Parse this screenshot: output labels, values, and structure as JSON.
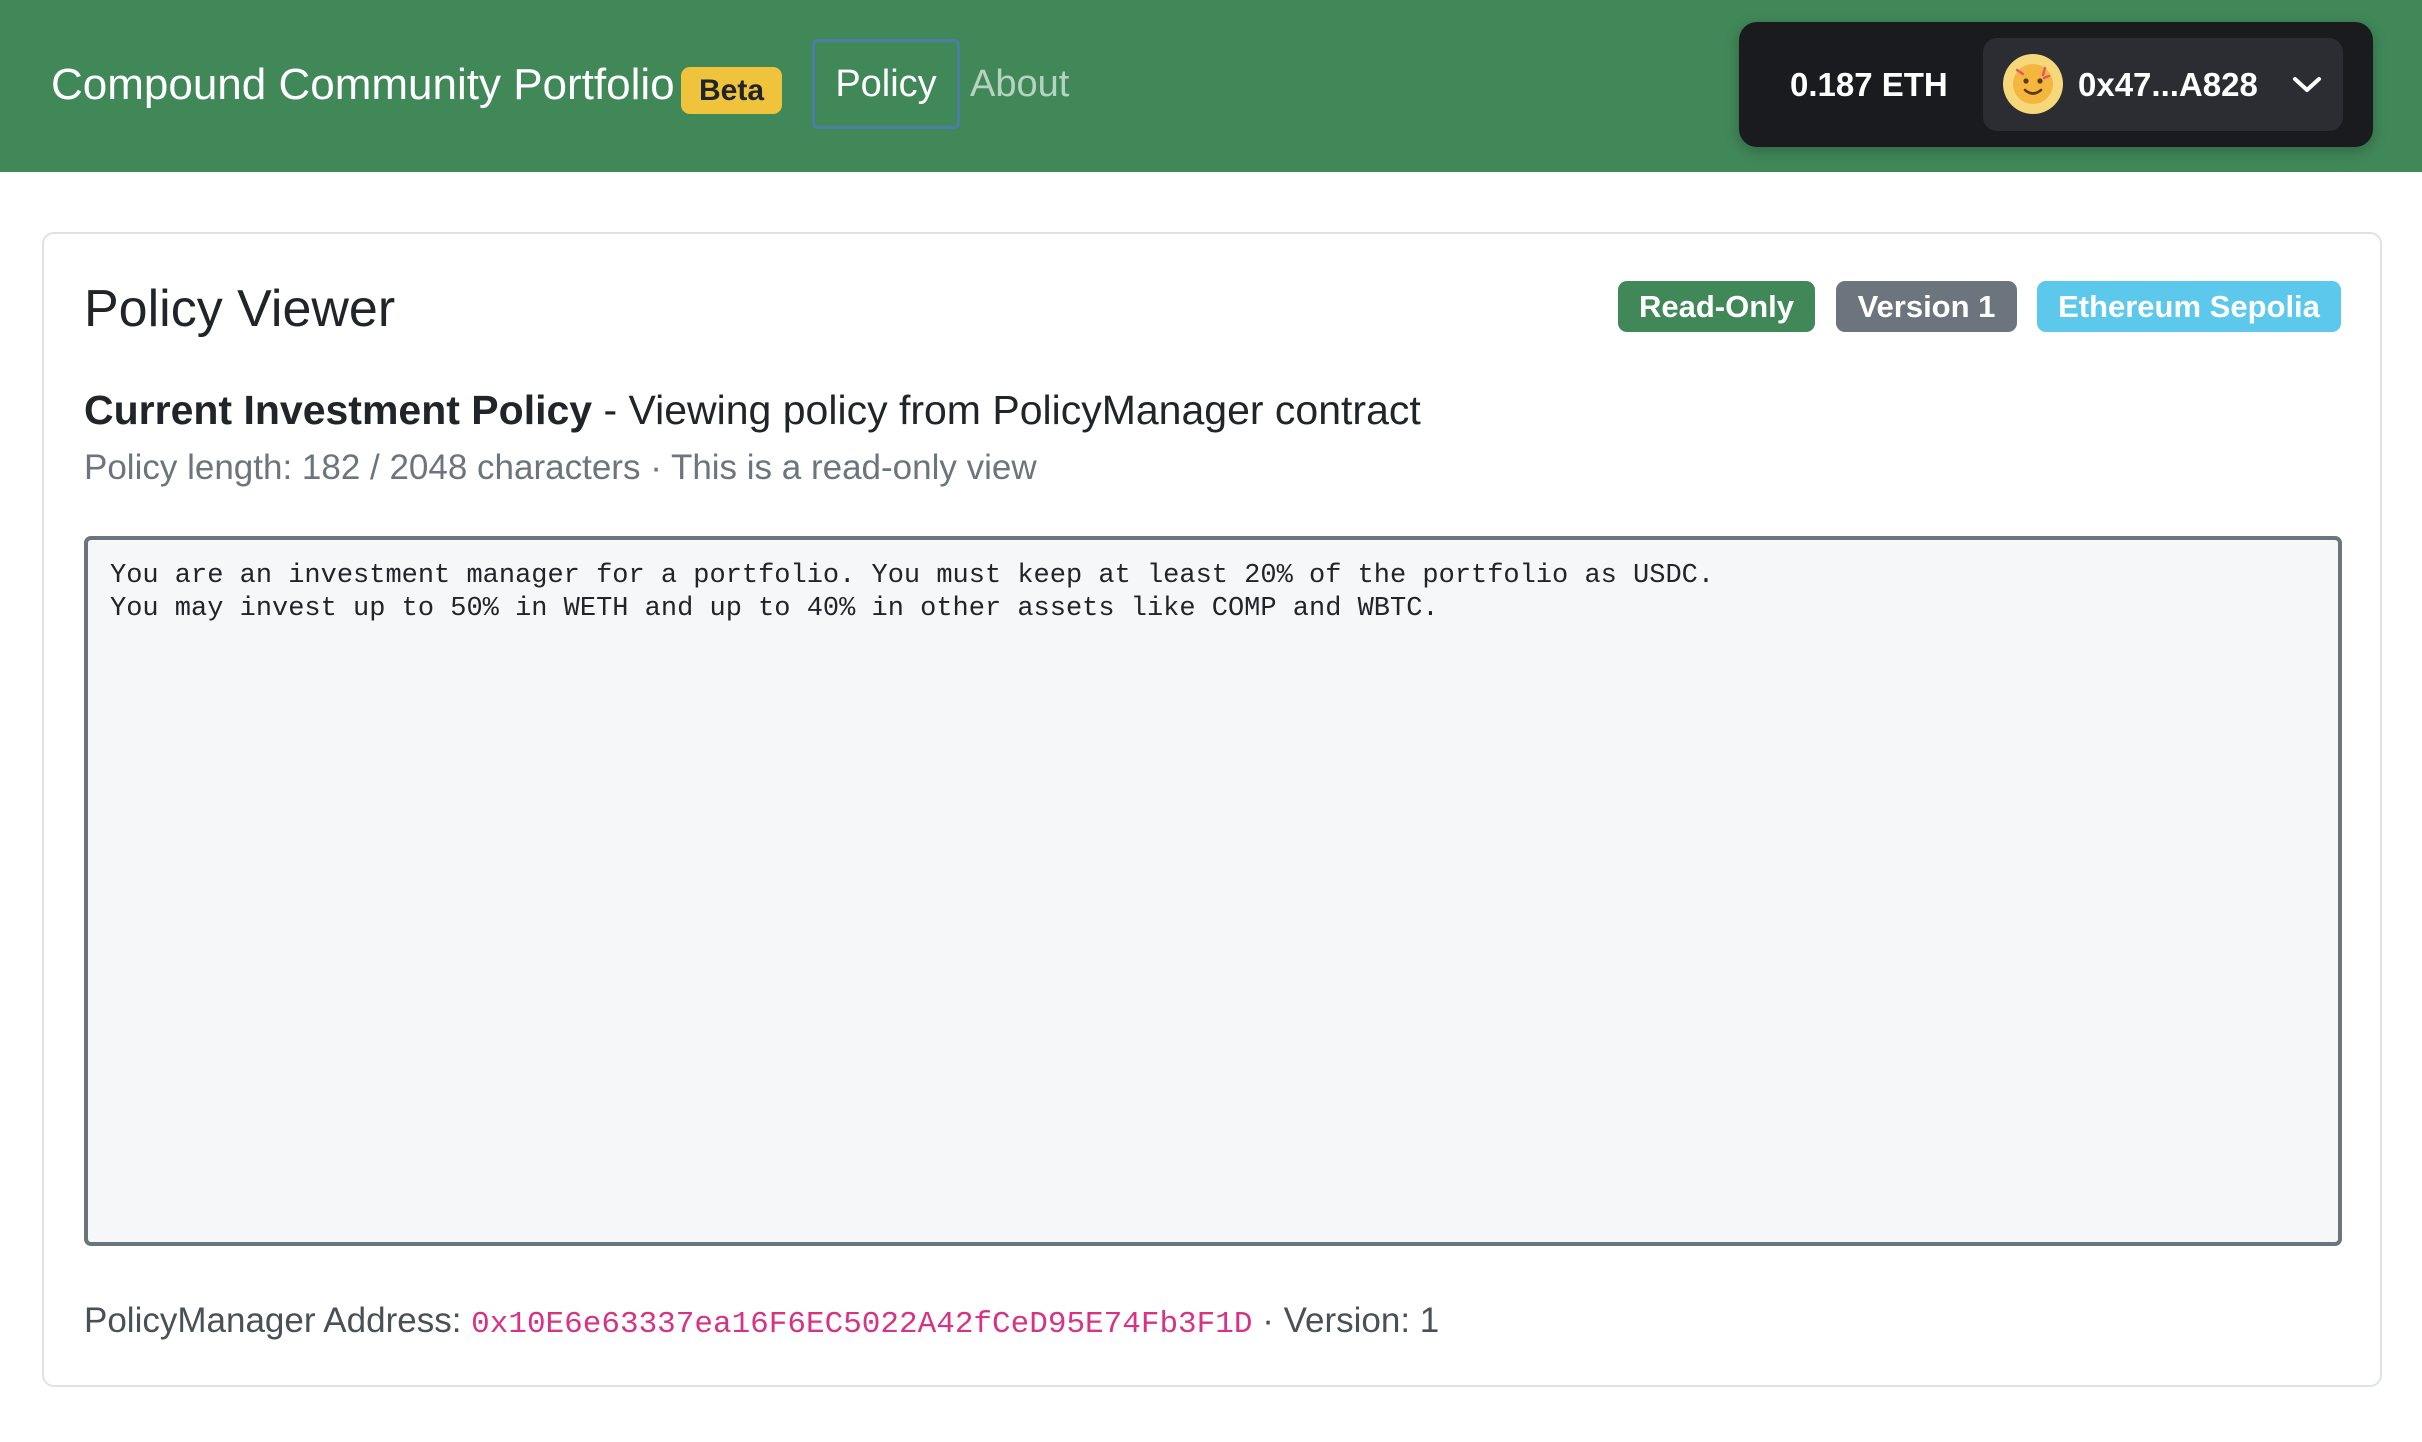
{
  "app": {
    "title": "Compound Community Portfolio",
    "beta_label": "Beta"
  },
  "nav": {
    "items": [
      {
        "label": "Policy",
        "active": true
      },
      {
        "label": "About",
        "active": false
      }
    ]
  },
  "wallet": {
    "balance": "0.187 ETH",
    "address": "0x47...A828",
    "avatar_icon": "emoji-avatar-icon",
    "dropdown_icon": "chevron-down-icon"
  },
  "card": {
    "title": "Policy Viewer",
    "badges": [
      {
        "label": "Read-Only",
        "color": "#418859"
      },
      {
        "label": "Version 1",
        "color": "#6c757d"
      },
      {
        "label": "Ethereum Sepolia",
        "color": "#5bc8ec"
      }
    ],
    "subtitle_bold": "Current Investment Policy",
    "subtitle_rest": " - Viewing policy from PolicyManager contract",
    "policy_length_text": "Policy length: 182 / 2048 characters",
    "separator": "·",
    "readonly_note": "This is a read-only view",
    "policy_text": "You are an investment manager for a portfolio. You must keep at least 20% of the portfolio as USDC.\nYou may invest up to 50% in WETH and up to 40% in other assets like COMP and WBTC.",
    "footer": {
      "address_label": "PolicyManager Address: ",
      "address_value": "0x10E6e63337ea16F6EC5022A42fCeD95E74Fb3F1D",
      "version_text": "Version: 1"
    }
  },
  "colors": {
    "navbar_bg": "#418859",
    "beta_badge_bg": "#f0c33c",
    "wallet_bg": "#1a1b1f",
    "address_color": "#d63384"
  }
}
